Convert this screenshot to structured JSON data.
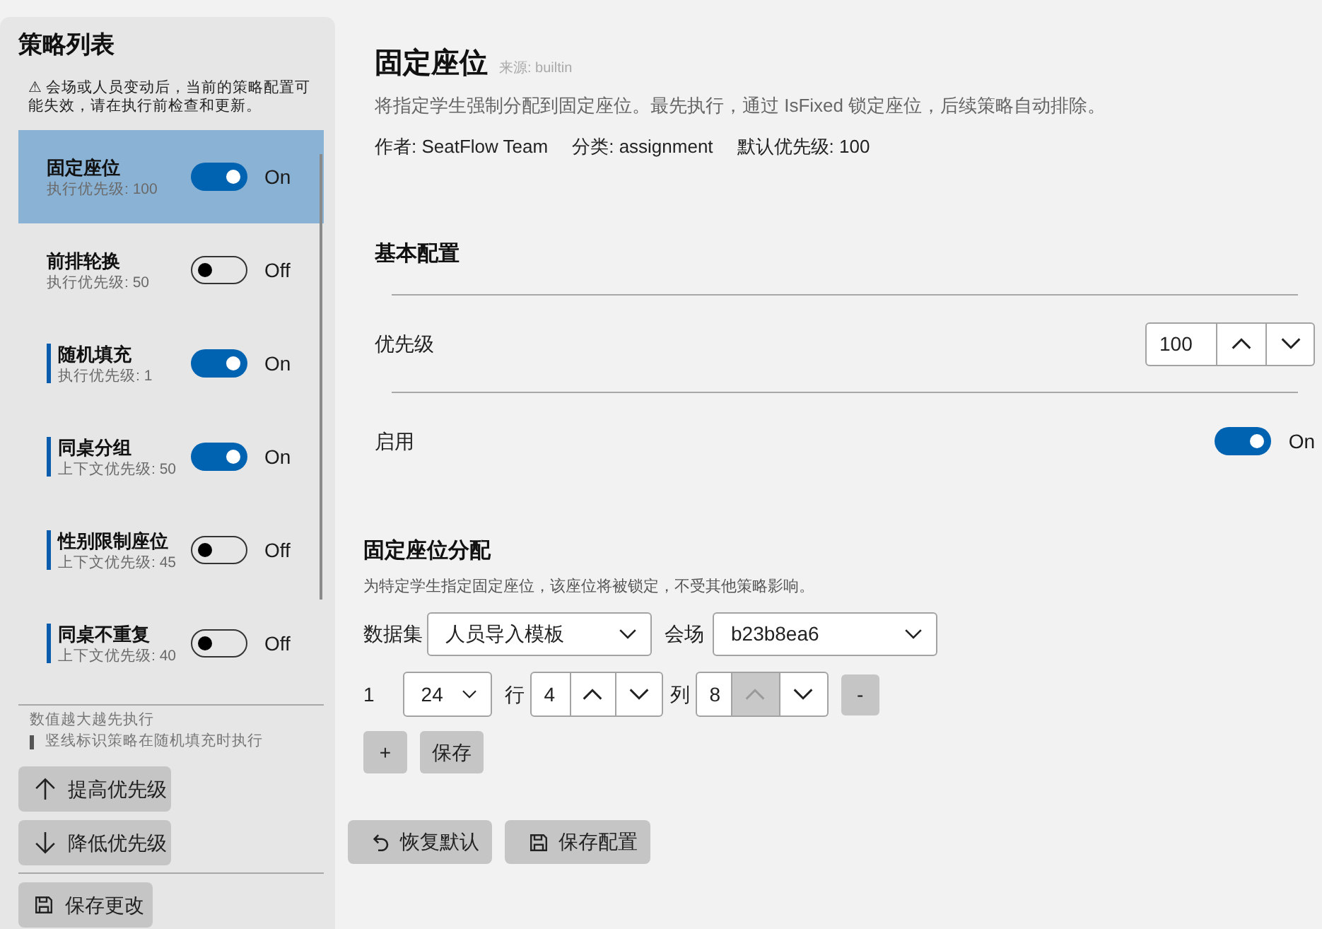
{
  "sidebar": {
    "title": "策略列表",
    "warning": "⚠ 会场或人员变动后，当前的策略配置可能失效，请在执行前检查和更新。",
    "strategies": [
      {
        "name": "固定座位",
        "priority": "执行优先级: 100",
        "on": true,
        "state_label": "On",
        "random_fill": false,
        "selected": true
      },
      {
        "name": "前排轮换",
        "priority": "执行优先级: 50",
        "on": false,
        "state_label": "Off",
        "random_fill": false,
        "selected": false
      },
      {
        "name": "随机填充",
        "priority": "执行优先级: 1",
        "on": true,
        "state_label": "On",
        "random_fill": true,
        "selected": false
      },
      {
        "name": "同桌分组",
        "priority": "上下文优先级: 50",
        "on": true,
        "state_label": "On",
        "random_fill": true,
        "selected": false
      },
      {
        "name": "性别限制座位",
        "priority": "上下文优先级: 45",
        "on": false,
        "state_label": "Off",
        "random_fill": true,
        "selected": false
      },
      {
        "name": "同桌不重复",
        "priority": "上下文优先级: 40",
        "on": false,
        "state_label": "Off",
        "random_fill": true,
        "selected": false
      }
    ],
    "notes": [
      {
        "kind": "plain",
        "text": "数值越大越先执行"
      },
      {
        "kind": "marker",
        "text": "竖线标识策略在随机填充时执行"
      }
    ],
    "priority_buttons": [
      {
        "kind": "raise",
        "label": "提高优先级"
      },
      {
        "kind": "lower",
        "label": "降低优先级"
      }
    ],
    "save_button": {
      "kind": "save",
      "label": "保存更改"
    }
  },
  "detail": {
    "title": "固定座位",
    "source": "来源: builtin",
    "description": "将指定学生强制分配到固定座位。最先执行，通过 IsFixed 锁定座位，后续策略自动排除。",
    "meta": [
      "作者: SeatFlow Team",
      "分类: assignment",
      "默认优先级: 100"
    ]
  },
  "basic_config": {
    "heading": "基本配置",
    "priority": {
      "label": "优先级",
      "spin": {
        "value": "100",
        "up_disabled": false,
        "down_disabled": false
      }
    },
    "enabled": {
      "label": "启用",
      "on": true,
      "state_label": "On"
    }
  },
  "fixed_seats": {
    "heading": "固定座位分配",
    "description": "为特定学生指定固定座位，该座位将被锁定，不受其他策略影响。",
    "dataset": {
      "label": "数据集",
      "value": "人员导入模板"
    },
    "venue": {
      "label": "会场",
      "value": "b23b8ea6"
    },
    "entries": [
      {
        "number": "1",
        "student": "24",
        "row_label": "行",
        "row": {
          "value": "4",
          "up_disabled": false,
          "down_disabled": false
        },
        "col_label": "列",
        "col": {
          "value": "8",
          "up_disabled": true,
          "down_disabled": false
        },
        "remove": "-"
      }
    ],
    "add": "+",
    "save": "保存"
  },
  "footer_buttons": [
    {
      "kind": "reset",
      "label": "恢复默认"
    },
    {
      "kind": "save",
      "label": "保存配置"
    }
  ]
}
